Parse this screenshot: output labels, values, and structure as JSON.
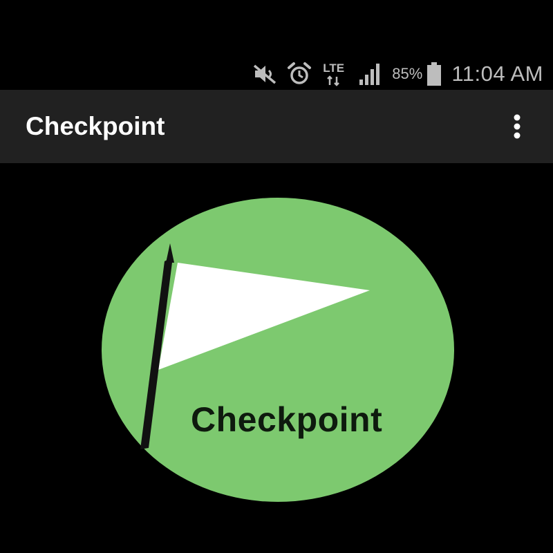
{
  "status_bar": {
    "icons": [
      "mute-icon",
      "alarm-icon",
      "lte-icon",
      "signal-icon",
      "battery-icon"
    ],
    "network": "LTE",
    "battery_percent": "85%",
    "time": "11:04 AM"
  },
  "app_bar": {
    "title": "Checkpoint",
    "overflow_icon": "more-vert-icon"
  },
  "logo": {
    "text": "Checkpoint",
    "circle_color": "#7dc96f",
    "flag_color": "#ffffff",
    "pole_color": "#111111"
  }
}
